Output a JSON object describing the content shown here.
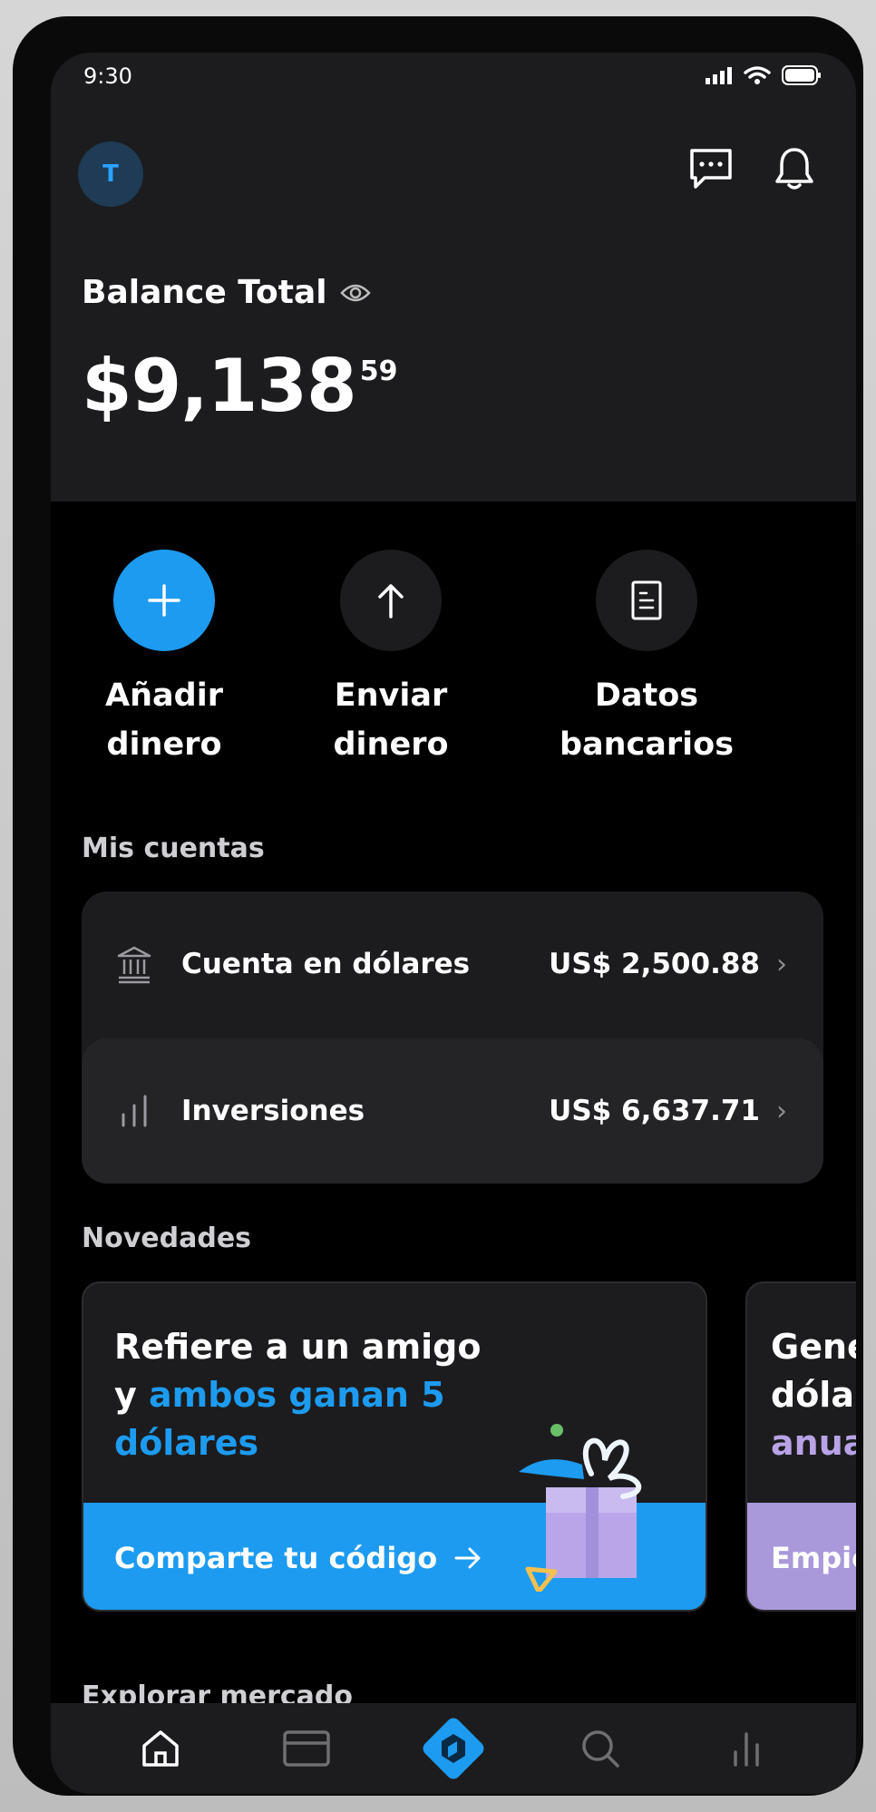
{
  "status_bar": {
    "time": "9:30"
  },
  "header": {
    "avatar_initial": "T"
  },
  "balance": {
    "label": "Balance Total",
    "amount_main": "$9,138",
    "amount_cents": "59"
  },
  "actions": [
    {
      "label_line1": "Añadir",
      "label_line2": "dinero",
      "icon": "plus-icon"
    },
    {
      "label_line1": "Enviar",
      "label_line2": "dinero",
      "icon": "arrow-up-icon"
    },
    {
      "label_line1": "Datos",
      "label_line2": "bancarios",
      "icon": "document-icon"
    }
  ],
  "accounts": {
    "title": "Mis cuentas",
    "items": [
      {
        "name": "Cuenta en dólares",
        "value": "US$ 2,500.88",
        "icon": "bank-icon"
      },
      {
        "name": "Inversiones",
        "value": "US$ 6,637.71",
        "icon": "bar-chart-icon"
      }
    ]
  },
  "news": {
    "title": "Novedades",
    "cards": [
      {
        "line1": "Refiere a un amigo",
        "line2_prefix": "y ",
        "line2_highlight": "ambos ganan 5",
        "line3_highlight": "dólares",
        "cta": "Comparte tu código"
      },
      {
        "line1": "Gene",
        "line2": "dóla",
        "line3_highlight": "anua",
        "cta": "Empie"
      }
    ]
  },
  "market": {
    "title": "Explorar mercado"
  },
  "nav": [
    "home-icon",
    "card-icon",
    "app-logo-icon",
    "search-icon",
    "stats-icon"
  ],
  "colors": {
    "accent": "#1d9bf0",
    "background": "#000000",
    "surface": "#1c1c1e",
    "purple": "#a999db"
  }
}
